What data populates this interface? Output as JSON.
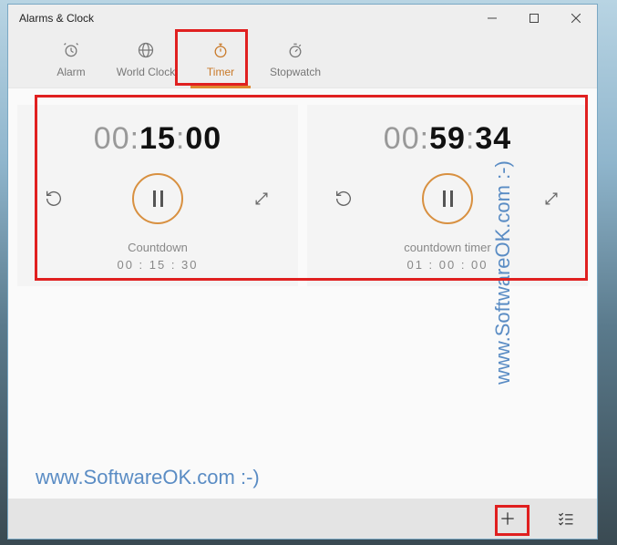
{
  "window": {
    "title": "Alarms & Clock"
  },
  "tabs": {
    "alarm": "Alarm",
    "worldclock": "World Clock",
    "timer": "Timer",
    "stopwatch": "Stopwatch"
  },
  "timers": [
    {
      "hours": "00",
      "minutes": "15",
      "seconds": "00",
      "label": "Countdown",
      "original": "00 : 15 : 30"
    },
    {
      "hours": "00",
      "minutes": "59",
      "seconds": "34",
      "label": "countdown timer",
      "original": "01 : 00 : 00"
    }
  ],
  "watermark": "www.SoftwareOK.com :-)"
}
